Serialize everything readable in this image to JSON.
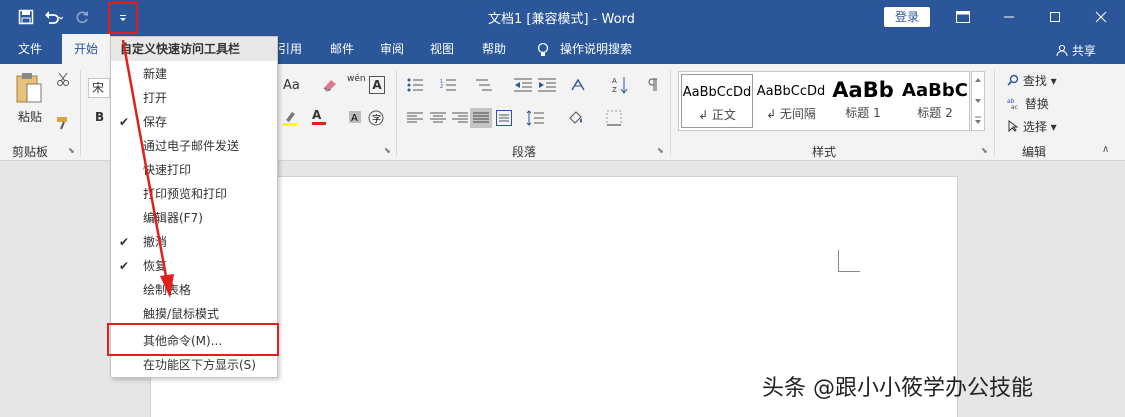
{
  "window": {
    "title": "文档1 [兼容模式] - Word",
    "login": "登录"
  },
  "tabs": [
    {
      "label": "文件"
    },
    {
      "label": "开始"
    },
    {
      "label": "引用"
    },
    {
      "label": "邮件"
    },
    {
      "label": "审阅"
    },
    {
      "label": "视图"
    },
    {
      "label": "帮助"
    },
    {
      "label": "操作说明搜索"
    }
  ],
  "share": "共享",
  "ribbon": {
    "clipboard": {
      "paste": "粘贴",
      "label": "剪贴板"
    },
    "font": {
      "name_partial": "宋",
      "bold": "B",
      "aa": "Aa",
      "wen": "wén",
      "char_a": "A"
    },
    "paragraph": {
      "label": "段落"
    },
    "styles": {
      "label": "样式",
      "items": [
        {
          "sample": "AaBbCcDd",
          "name": "↲ 正文"
        },
        {
          "sample": "AaBbCcDd",
          "name": "↲ 无间隔"
        },
        {
          "sample": "AaBb",
          "name": "标题 1"
        },
        {
          "sample": "AaBbC",
          "name": "标题 2"
        }
      ]
    },
    "editing": {
      "find": "查找",
      "replace": "替换",
      "select": "选择",
      "label": "编辑"
    }
  },
  "menu": {
    "header": "自定义快速访问工具栏",
    "items": [
      {
        "label": "新建",
        "checked": false
      },
      {
        "label": "打开",
        "checked": false
      },
      {
        "label": "保存",
        "checked": true
      },
      {
        "label": "通过电子邮件发送",
        "checked": false
      },
      {
        "label": "快速打印",
        "checked": false
      },
      {
        "label": "打印预览和打印",
        "checked": false
      },
      {
        "label": "编辑器(F7)",
        "checked": false
      },
      {
        "label": "撤消",
        "checked": true
      },
      {
        "label": "恢复",
        "checked": true
      },
      {
        "label": "绘制表格",
        "checked": false
      },
      {
        "label": "触摸/鼠标模式",
        "checked": false
      },
      {
        "label": "其他命令(M)...",
        "checked": false
      },
      {
        "label": "在功能区下方显示(S)",
        "checked": false
      }
    ],
    "check_glyph": "✔"
  },
  "watermark": "头条 @跟小小筱学办公技能",
  "colors": {
    "brand": "#2b579a",
    "highlight": "#e0201c"
  }
}
